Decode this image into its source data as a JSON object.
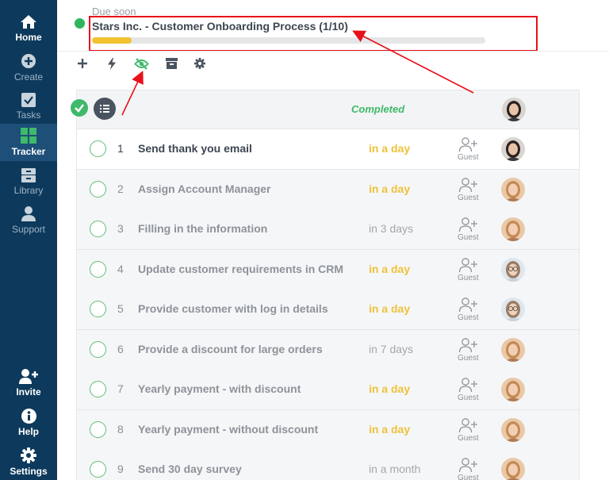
{
  "sidebar": {
    "items": [
      {
        "label": "Home",
        "icon": "home-icon"
      },
      {
        "label": "Create",
        "icon": "plus-circle-icon"
      },
      {
        "label": "Tasks",
        "icon": "checkbox-icon"
      },
      {
        "label": "Tracker",
        "icon": "grid-icon"
      },
      {
        "label": "Library",
        "icon": "archive-icon"
      },
      {
        "label": "Support",
        "icon": "user-icon"
      },
      {
        "label": "Invite",
        "icon": "user-plus-icon"
      },
      {
        "label": "Help",
        "icon": "info-icon"
      },
      {
        "label": "Settings",
        "icon": "gear-icon"
      }
    ]
  },
  "header": {
    "due_label": "Due soon",
    "title": "Stars Inc. - Customer Onboarding Process (1/10)",
    "progress_fraction": 0.1,
    "status_color": "#2fb55a",
    "accent_color": "#f2c230",
    "annotation_color": "#e8101a"
  },
  "toolbar": {
    "icons": [
      "plus-icon",
      "bolt-icon",
      "eye-slash-icon",
      "archive-icon",
      "gear-icon"
    ]
  },
  "table": {
    "header_status": "Completed",
    "guest_label": "Guest",
    "rows": [
      {
        "num": "1",
        "task": "Send thank you email",
        "due": "in a day",
        "avatar": "woman-dark"
      },
      {
        "num": "2",
        "task": "Assign Account Manager",
        "due": "in a day",
        "avatar": "woman-blonde"
      },
      {
        "num": "3",
        "task": "Filling in the information",
        "due": "in 3 days",
        "avatar": "woman-blonde"
      },
      {
        "num": "4",
        "task": "Update customer requirements in CRM",
        "due": "in a day",
        "avatar": "woman-glasses"
      },
      {
        "num": "5",
        "task": "Provide customer with log in details",
        "due": "in a day",
        "avatar": "woman-glasses"
      },
      {
        "num": "6",
        "task": "Provide a discount for large orders",
        "due": "in 7 days",
        "avatar": "woman-blonde"
      },
      {
        "num": "7",
        "task": "Yearly payment - with discount",
        "due": "in a day",
        "avatar": "woman-blonde"
      },
      {
        "num": "8",
        "task": "Yearly payment - without discount",
        "due": "in a day",
        "avatar": "woman-blonde"
      },
      {
        "num": "9",
        "task": "Send 30 day survey",
        "due": "in a month",
        "avatar": "woman-blonde"
      }
    ]
  }
}
